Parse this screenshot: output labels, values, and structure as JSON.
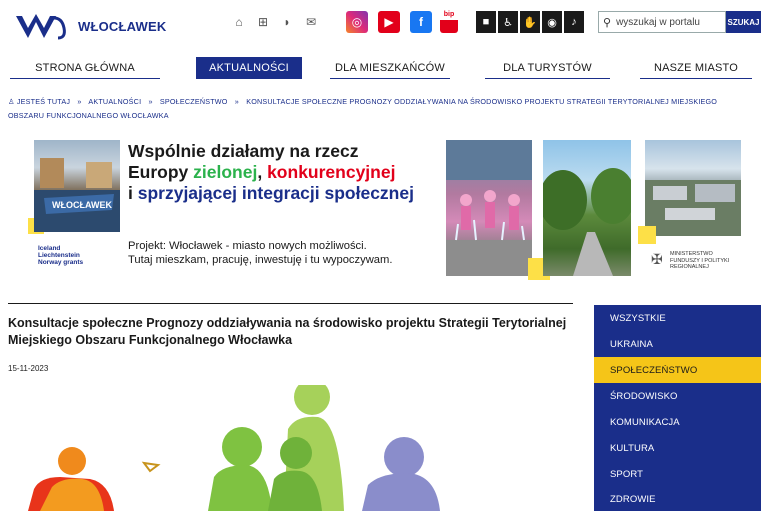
{
  "header": {
    "logo_text": "WŁOCŁAWEK",
    "top_icons": [
      "home-icon",
      "sitemap-icon",
      "rss-icon",
      "mail-icon"
    ],
    "social": [
      "instagram-icon",
      "youtube-icon",
      "facebook-icon",
      "bip-icon"
    ],
    "bip_label": "bip",
    "accessibility": [
      "contrast-icon",
      "wheelchair-icon",
      "sign-language-icon",
      "low-vision-icon",
      "hearing-icon"
    ],
    "search_placeholder": "wyszukaj w portalu",
    "search_button": "SZUKAJ"
  },
  "nav": {
    "items": [
      "STRONA GŁÓWNA",
      "AKTUALNOŚCI",
      "DLA MIESZKAŃCÓW",
      "DLA TURYSTÓW",
      "NASZE MIASTO"
    ],
    "active_index": 1
  },
  "breadcrumb": {
    "prefix": "JESTEŚ TUTAJ",
    "items": [
      "AKTUALNOŚCI",
      "SPOŁECZEŃSTWO",
      "KONSULTACJE SPOŁECZNE PROGNOZY ODDZIAŁYWANIA NA ŚRODOWISKO PROJEKTU STRATEGII TERYTORIALNEJ MIEJSKIEGO OBSZARU FUNKCJONALNEGO WŁOCŁAWKA"
    ]
  },
  "banner": {
    "line1": "Wspólnie działamy na rzecz",
    "line2_a": "Europy ",
    "line2_green": "zielonej",
    "line2_b": ", ",
    "line2_red": "konkurencyjnej",
    "line3_a": "i ",
    "line3_blue": "sprzyjającej integracji społecznej",
    "project_1": "Projekt: Włocławek - miasto nowych możliwości.",
    "project_2": "Tutaj mieszkam, pracuję, inwestuję i tu wypoczywam.",
    "eea_1": "Iceland",
    "eea_2": "Liechtenstein",
    "eea_3": "Norway grants",
    "ministry_1": "MINISTERSTWO",
    "ministry_2": "FUNDUSZY I POLITYKI",
    "ministry_3": "REGIONALNEJ",
    "colors": {
      "green": "#2bb24c",
      "red": "#e2001a",
      "blue": "#1a2e8a"
    }
  },
  "article": {
    "title": "Konsultacje społeczne Prognozy oddziaływania na środowisko projektu Strategii Terytorialnej Miejskiego Obszaru Funkcjonalnego Włocławka",
    "date": "15-11-2023"
  },
  "sidebar": {
    "categories": [
      "WSZYSTKIE",
      "UKRAINA",
      "SPOŁECZEŃSTWO",
      "ŚRODOWISKO",
      "KOMUNIKACJA",
      "KULTURA",
      "SPORT",
      "ZDROWIE"
    ],
    "selected_index": 2
  },
  "colors": {
    "brand": "#1a2e8a",
    "highlight": "#f5c518"
  }
}
